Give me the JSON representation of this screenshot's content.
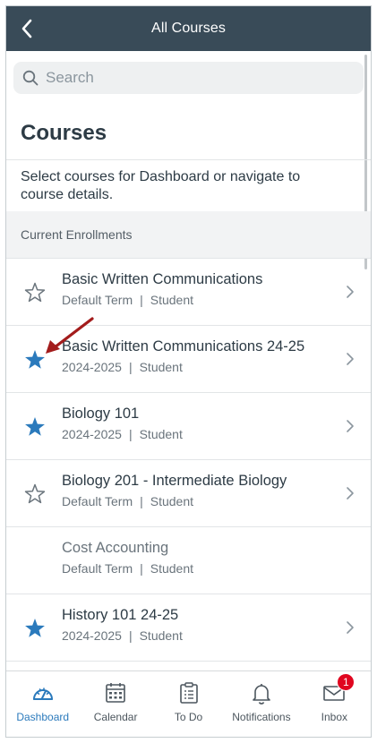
{
  "header": {
    "title": "All Courses"
  },
  "search": {
    "placeholder": "Search",
    "value": ""
  },
  "main": {
    "heading": "Courses",
    "description": "Select courses for Dashboard or navigate to course details.",
    "section_title": "Current Enrollments"
  },
  "courses": [
    {
      "name": "Basic Written Communications",
      "term": "Default Term",
      "role": "Student",
      "favorite": false,
      "chevron": true
    },
    {
      "name": "Basic Written Communications 24-25",
      "term": "2024-2025",
      "role": "Student",
      "favorite": true,
      "chevron": true
    },
    {
      "name": "Biology 101",
      "term": "2024-2025",
      "role": "Student",
      "favorite": true,
      "chevron": true
    },
    {
      "name": "Biology 201 - Intermediate Biology",
      "term": "Default Term",
      "role": "Student",
      "favorite": false,
      "chevron": true
    },
    {
      "name": "Cost Accounting",
      "term": "Default Term",
      "role": "Student",
      "favorite": null,
      "chevron": false
    },
    {
      "name": "History 101 24-25",
      "term": "2024-2025",
      "role": "Student",
      "favorite": true,
      "chevron": true
    }
  ],
  "separator": "|",
  "tabs": [
    {
      "label": "Dashboard",
      "icon": "dashboard-icon",
      "active": true
    },
    {
      "label": "Calendar",
      "icon": "calendar-icon",
      "active": false
    },
    {
      "label": "To Do",
      "icon": "todo-icon",
      "active": false
    },
    {
      "label": "Notifications",
      "icon": "bell-icon",
      "active": false
    },
    {
      "label": "Inbox",
      "icon": "mail-icon",
      "active": false,
      "badge": "1"
    }
  ],
  "colors": {
    "navbar": "#394b58",
    "accent": "#2b7abc",
    "star_filled": "#2b7abc",
    "star_empty": "#6a747c",
    "annotation_arrow": "#a31c1c",
    "badge": "#e0061f"
  }
}
